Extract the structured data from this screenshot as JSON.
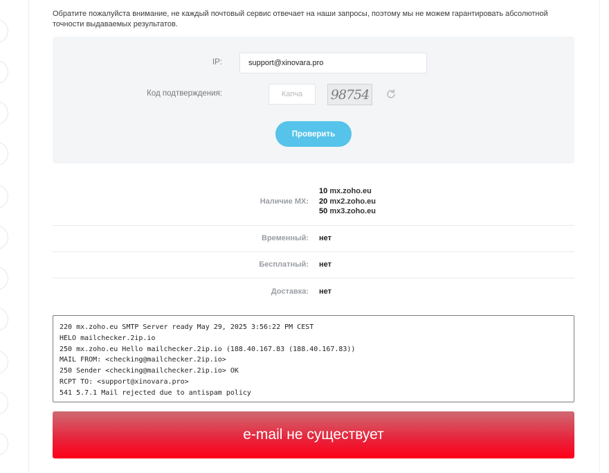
{
  "notice": "Обратите пожалуйста внимание, не каждый почтовый сервис отвечает на наши запросы, поэтому мы не можем гарантировать абсолютной точности выдаваемых результатов.",
  "form": {
    "ip_label": "IP:",
    "ip_value": "support@xinovara.pro",
    "captcha_label": "Код подтверждения:",
    "captcha_placeholder": "Капча",
    "captcha_text": "98754",
    "check_label": "Проверить"
  },
  "results": {
    "mx_label": "Наличие MX:",
    "mx_records": [
      {
        "priority": "10",
        "host": "mx.zoho.eu"
      },
      {
        "priority": "20",
        "host": "mx2.zoho.eu"
      },
      {
        "priority": "50",
        "host": "mx3.zoho.eu"
      }
    ],
    "temporary_label": "Временный:",
    "temporary_value": "нет",
    "free_label": "Бесплатный:",
    "free_value": "нет",
    "delivery_label": "Доставка:",
    "delivery_value": "нет"
  },
  "log": [
    "220 mx.zoho.eu SMTP Server ready May 29, 2025 3:56:22 PM CEST",
    "HELO mailchecker.2ip.io",
    "250 mx.zoho.eu Hello mailchecker.2ip.io (188.40.167.83 (188.40.167.83))",
    "MAIL FROM: <checking@mailchecker.2ip.io>",
    "250 Sender <checking@mailchecker.2ip.io> OK",
    "RCPT TO: <support@xinovara.pro>",
    "541 5.7.1 Mail rejected due to antispam policy"
  ],
  "result_text": "e-mail не существует",
  "colors": {
    "button": "#55c3ea",
    "banner_top": "#cf6a72",
    "banner_bottom": "#ff0018",
    "form_bg": "#f3f5f7"
  }
}
